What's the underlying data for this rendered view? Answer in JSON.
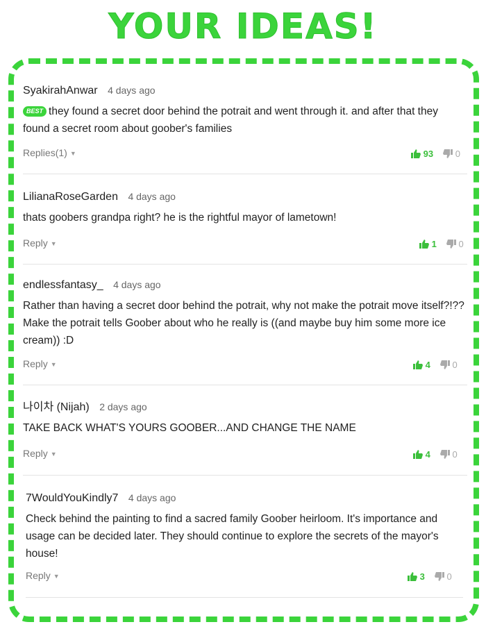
{
  "header": {
    "title": "YOUR IDEAS!"
  },
  "colors": {
    "accent": "#3bd43b",
    "muted": "#aaaaaa"
  },
  "comments": [
    {
      "user": "SyakirahAnwar",
      "date": "4 days ago",
      "badge": "BEST",
      "text": "they found a secret door behind the potrait and went through it. and after that they found a secret room about goober's families",
      "reply_label": "Replies(1)",
      "upvotes": "93",
      "downvotes": "0"
    },
    {
      "user": "LilianaRoseGarden",
      "date": "4 days ago",
      "text": "thats goobers grandpa right? he is the rightful mayor of lametown!",
      "reply_label": "Reply",
      "upvotes": "1",
      "downvotes": "0"
    },
    {
      "user": "endlessfantasy_",
      "date": "4 days ago",
      "text": "Rather than having a secret door behind the potrait, why not make the potrait move itself?!?? Make the potrait tells Goober about who he really is ((and maybe buy him some more ice cream)) :D",
      "reply_label": "Reply",
      "upvotes": "4",
      "downvotes": "0"
    },
    {
      "user": "나이차 (Nijah)",
      "date": "2 days ago",
      "text": "TAKE BACK WHAT'S YOURS GOOBER...AND CHANGE THE NAME",
      "reply_label": "Reply",
      "upvotes": "4",
      "downvotes": "0"
    },
    {
      "user": "7WouldYouKindly7",
      "date": "4 days ago",
      "text": "Check behind the painting to find a sacred family Goober heirloom. It's importance and usage can be decided later. They should continue to explore the secrets of the mayor's house!",
      "reply_label": "Reply",
      "upvotes": "3",
      "downvotes": "0"
    }
  ]
}
